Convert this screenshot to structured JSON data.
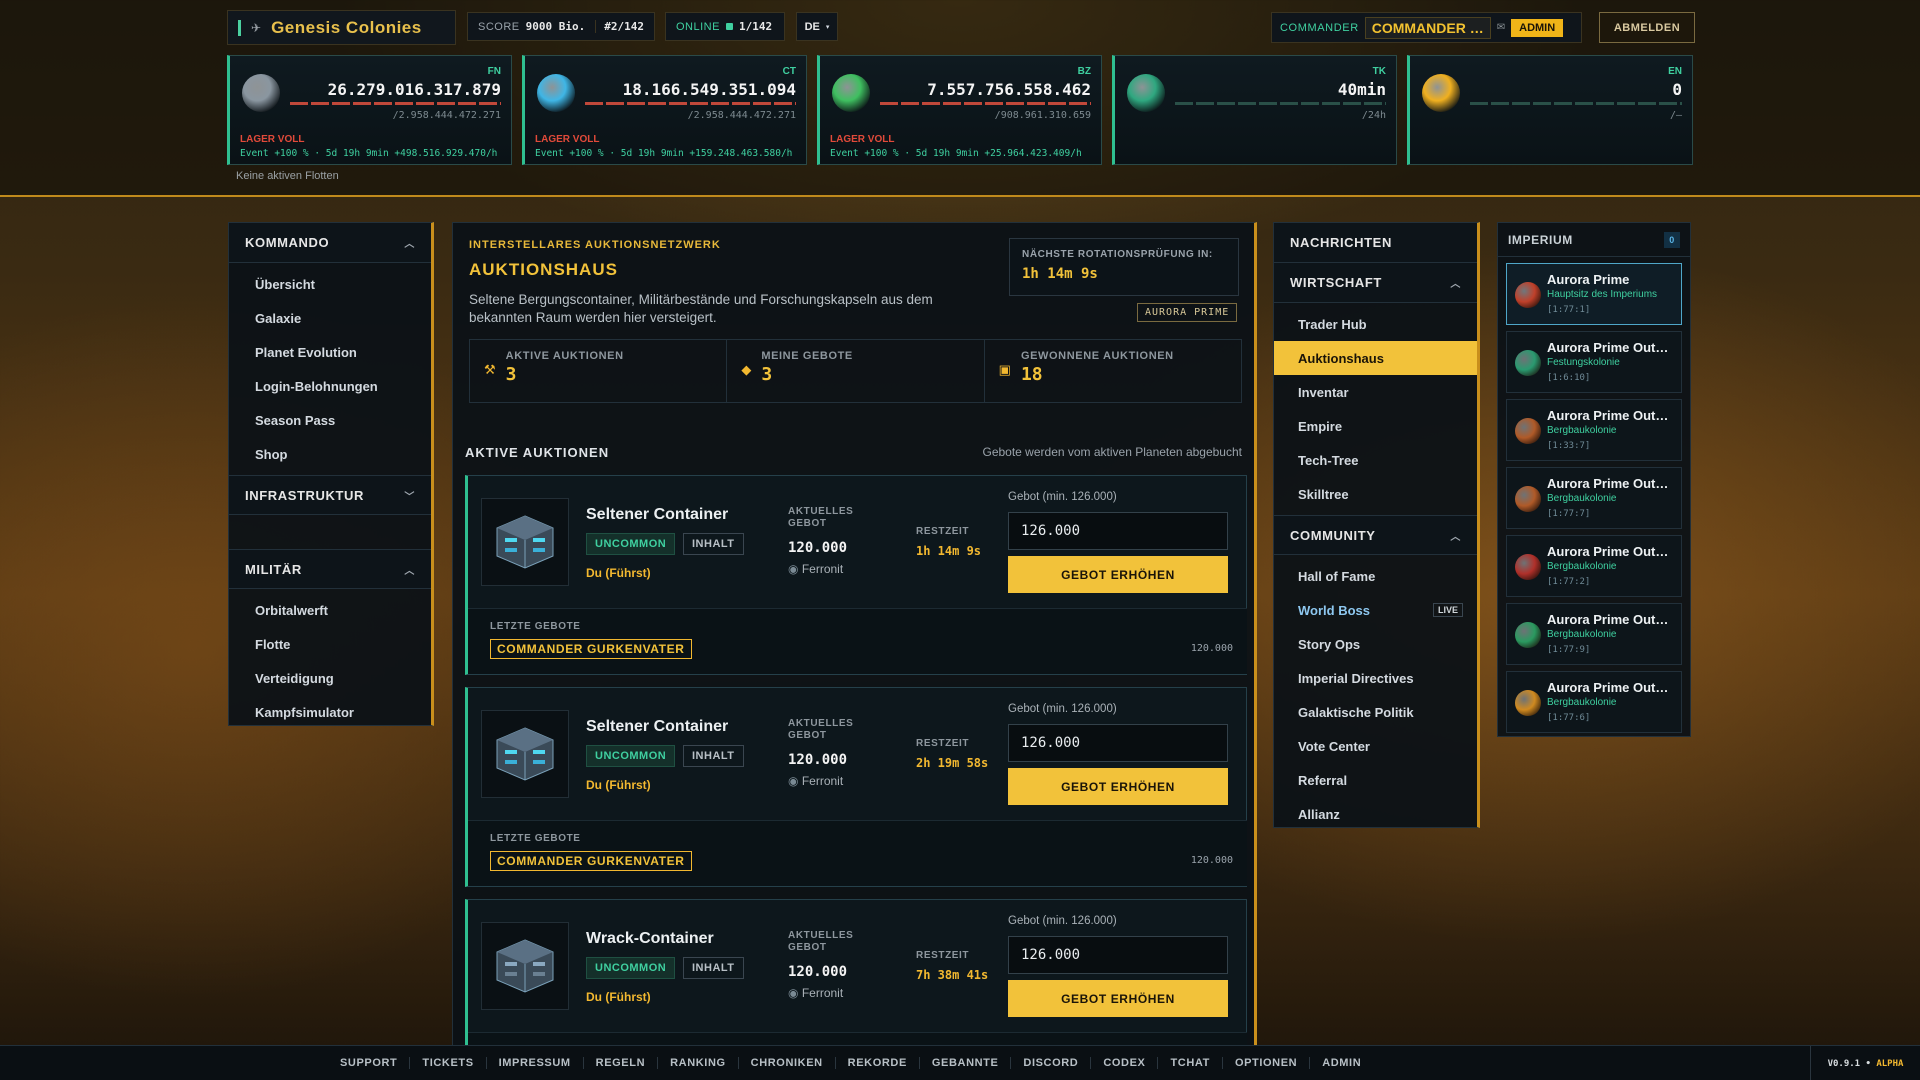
{
  "header": {
    "app_title": "Genesis Colonies",
    "score_label": "SCORE",
    "score_value": "9000 Bio.",
    "rank": "#2/142",
    "online_label": "ONLINE",
    "online_value": "1/142",
    "language": "DE",
    "commander_label": "COMMANDER",
    "commander_name": "COMMANDER …",
    "admin_badge": "ADMIN",
    "logout": "ABMELDEN"
  },
  "resources": [
    {
      "code": "FN",
      "value": "26.279.016.317.879",
      "capacity": "/2.958.444.472.271",
      "status": "LAGER VOLL",
      "event": "Event +100 % · 5d 19h 9min  +498.516.929.470/h",
      "color": "#8a96a0"
    },
    {
      "code": "CT",
      "value": "18.166.549.351.094",
      "capacity": "/2.958.444.472.271",
      "status": "LAGER VOLL",
      "event": "Event +100 % · 5d 19h 9min  +159.248.463.580/h",
      "color": "#3fb6e6"
    },
    {
      "code": "BZ",
      "value": "7.557.756.558.462",
      "capacity": "/908.961.310.659",
      "status": "LAGER VOLL",
      "event": "Event +100 % · 5d 19h 9min  +25.964.423.409/h",
      "color": "#3fbf60"
    },
    {
      "code": "TK",
      "value": "40min",
      "capacity": "/24h",
      "status": "",
      "event": "",
      "color": "#2fa880"
    },
    {
      "code": "EN",
      "value": "0",
      "capacity": "/—",
      "status": "",
      "event": "",
      "color": "#f0b020"
    }
  ],
  "fleet_status": "Keine aktiven Flotten",
  "left_nav": {
    "kommando": "KOMMANDO",
    "kommando_items": [
      "Übersicht",
      "Galaxie",
      "Planet Evolution",
      "Login-Belohnungen",
      "Season Pass",
      "Shop"
    ],
    "infrastruktur": "INFRASTRUKTUR",
    "militaer": "MILITÄR",
    "militaer_items": [
      "Orbitalwerft",
      "Flotte",
      "Verteidigung",
      "Kampfsimulator"
    ]
  },
  "auction": {
    "subtitle": "INTERSTELLARES AUKTIONSNETZWERK",
    "title": "AUKTIONSHAUS",
    "description": "Seltene Bergungscontainer, Militärbestände und Forschungskapseln aus dem bekannten Raum werden hier versteigert.",
    "rotation_label": "NÄCHSTE ROTATIONSPRÜFUNG IN:",
    "rotation_value": "1h 14m 9s",
    "planet_tag": "AURORA PRIME",
    "stats": [
      {
        "label": "AKTIVE AUKTIONEN",
        "value": "3",
        "icon": "⚒"
      },
      {
        "label": "MEINE GEBOTE",
        "value": "3",
        "icon": "◆"
      },
      {
        "label": "GEWONNENE AUKTIONEN",
        "value": "18",
        "icon": "▣"
      }
    ],
    "active_heading": "AKTIVE AUKTIONEN",
    "active_note": "Gebote werden vom aktiven Planeten abgebucht",
    "cards": [
      {
        "name": "Seltener Container",
        "rarity": "UNCOMMON",
        "content": "INHALT",
        "leader": "Du (Führst)",
        "current_label": "AKTUELLES GEBOT",
        "current_value": "120.000",
        "currency": "Ferronit",
        "remaining_label": "RESTZEIT",
        "remaining_value": "1h 14m 9s",
        "bid_label": "Gebot (min. 126.000)",
        "bid_value": "126.000",
        "bid_button": "GEBOT ERHÖHEN",
        "last_label": "LETZTE GEBOTE",
        "last_bidder": "COMMANDER GURKENVATER",
        "last_value": "120.000"
      },
      {
        "name": "Seltener Container",
        "rarity": "UNCOMMON",
        "content": "INHALT",
        "leader": "Du (Führst)",
        "current_label": "AKTUELLES GEBOT",
        "current_value": "120.000",
        "currency": "Ferronit",
        "remaining_label": "RESTZEIT",
        "remaining_value": "2h 19m 58s",
        "bid_label": "Gebot (min. 126.000)",
        "bid_value": "126.000",
        "bid_button": "GEBOT ERHÖHEN",
        "last_label": "LETZTE GEBOTE",
        "last_bidder": "COMMANDER GURKENVATER",
        "last_value": "120.000"
      },
      {
        "name": "Wrack-Container",
        "rarity": "UNCOMMON",
        "content": "INHALT",
        "leader": "Du (Führst)",
        "current_label": "AKTUELLES GEBOT",
        "current_value": "120.000",
        "currency": "Ferronit",
        "remaining_label": "RESTZEIT",
        "remaining_value": "7h 38m 41s",
        "bid_label": "Gebot (min. 126.000)",
        "bid_value": "126.000",
        "bid_button": "GEBOT ERHÖHEN",
        "last_label": "LETZTE GEBOTE",
        "last_bidder": "",
        "last_value": ""
      }
    ]
  },
  "right_nav": {
    "nachrichten": "NACHRICHTEN",
    "wirtschaft": "WIRTSCHAFT",
    "wirtschaft_items": [
      "Trader Hub",
      "Auktionshaus",
      "Inventar",
      "Empire",
      "Tech-Tree",
      "Skilltree"
    ],
    "community": "COMMUNITY",
    "community_items": [
      "Hall of Fame",
      "World Boss",
      "Story Ops",
      "Imperial Directives",
      "Galaktische Politik",
      "Vote Center",
      "Referral",
      "Allianz"
    ],
    "live_badge": "LIVE"
  },
  "imperium": {
    "title": "IMPERIUM",
    "count": "0",
    "planets": [
      {
        "name": "Aurora Prime",
        "sub": "Hauptsitz des Imperiums",
        "coords": "[1:77:1]",
        "color": "#c0402a"
      },
      {
        "name": "Aurora Prime Out…",
        "sub": "Festungskolonie",
        "coords": "[1:6:10]",
        "color": "#2a9a70"
      },
      {
        "name": "Aurora Prime Out…",
        "sub": "Bergbaukolonie",
        "coords": "[1:33:7]",
        "color": "#b05a28"
      },
      {
        "name": "Aurora Prime Out…",
        "sub": "Bergbaukolonie",
        "coords": "[1:77:7]",
        "color": "#b05a28"
      },
      {
        "name": "Aurora Prime Out…",
        "sub": "Bergbaukolonie",
        "coords": "[1:77:2]",
        "color": "#b0302a"
      },
      {
        "name": "Aurora Prime Out…",
        "sub": "Bergbaukolonie",
        "coords": "[1:77:9]",
        "color": "#2a9a60"
      },
      {
        "name": "Aurora Prime Out…",
        "sub": "Bergbaukolonie",
        "coords": "[1:77:6]",
        "color": "#d08a20"
      }
    ]
  },
  "footer": {
    "links": [
      "SUPPORT",
      "TICKETS",
      "IMPRESSUM",
      "REGELN",
      "RANKING",
      "CHRONIKEN",
      "REKORDE",
      "GEBANNTE",
      "DISCORD",
      "CODEX",
      "TCHAT",
      "OPTIONEN",
      "ADMIN"
    ],
    "version": "V0.9.1",
    "version_tag": "ALPHA"
  }
}
